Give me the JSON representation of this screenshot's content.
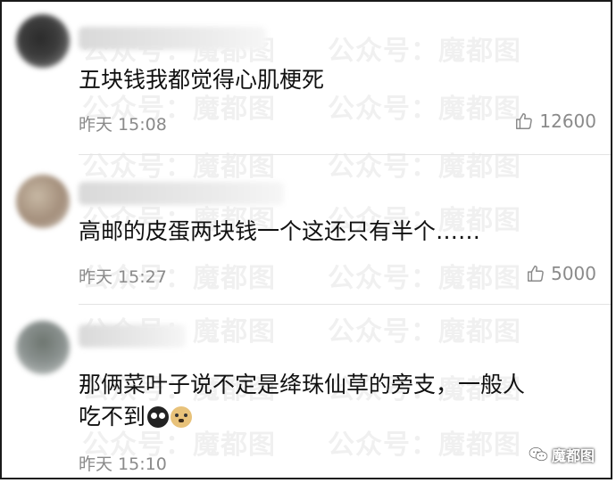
{
  "comments": [
    {
      "text_lines": [
        "五块钱我都觉得心肌梗死"
      ],
      "time": "昨天 15:08",
      "likes": "12600"
    },
    {
      "text_lines": [
        "高邮的皮蛋两块钱一个这还只有半个……"
      ],
      "time": "昨天 15:27",
      "likes": "5000"
    },
    {
      "text_lines": [
        "那俩菜叶子说不定是绛珠仙草的旁支，一般人",
        "吃不到"
      ],
      "emojis": [
        "crying-face-icon",
        "doge-icon"
      ],
      "time": "昨天 15:10"
    }
  ],
  "watermark": {
    "text": "公众号：魔都图",
    "badge_text": "魔都图"
  },
  "colors": {
    "text": "#111111",
    "meta": "#8a8a8a",
    "divider": "#e3e3e3",
    "border": "#1a1a1a"
  }
}
